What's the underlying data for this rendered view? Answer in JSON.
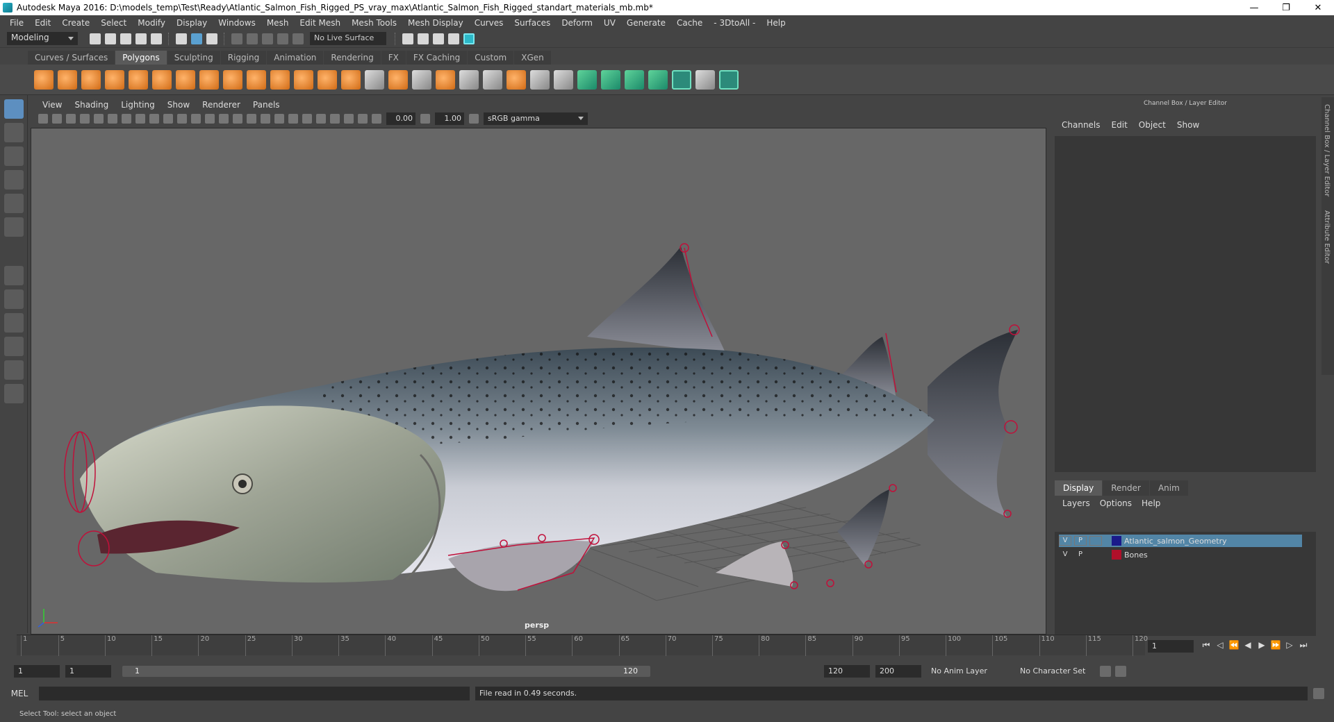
{
  "window": {
    "title": "Autodesk Maya 2016: D:\\models_temp\\Test\\Ready\\Atlantic_Salmon_Fish_Rigged_PS_vray_max\\Atlantic_Salmon_Fish_Rigged_standart_materials_mb.mb*",
    "min": "—",
    "max": "❐",
    "close": "✕"
  },
  "menubar": [
    "File",
    "Edit",
    "Create",
    "Select",
    "Modify",
    "Display",
    "Windows",
    "Mesh",
    "Edit Mesh",
    "Mesh Tools",
    "Mesh Display",
    "Curves",
    "Surfaces",
    "Deform",
    "UV",
    "Generate",
    "Cache",
    "- 3DtoAll -",
    "Help"
  ],
  "statusline": {
    "mode": "Modeling",
    "live_surface": "No Live Surface"
  },
  "shelf_tabs": [
    "Curves / Surfaces",
    "Polygons",
    "Sculpting",
    "Rigging",
    "Animation",
    "Rendering",
    "FX",
    "FX Caching",
    "Custom",
    "XGen"
  ],
  "shelf_active": "Polygons",
  "viewport": {
    "menu": [
      "View",
      "Shading",
      "Lighting",
      "Show",
      "Renderer",
      "Panels"
    ],
    "exposure": "0.00",
    "gamma_value": "1.00",
    "color_space": "sRGB gamma",
    "camera": "persp"
  },
  "channel_box": {
    "title": "Channel Box / Layer Editor",
    "menu": [
      "Channels",
      "Edit",
      "Object",
      "Show"
    ]
  },
  "layer_editor": {
    "tabs": [
      "Display",
      "Render",
      "Anim"
    ],
    "active_tab": "Display",
    "menu": [
      "Layers",
      "Options",
      "Help"
    ],
    "layers": [
      {
        "v": "V",
        "p": "P",
        "name": "Atlantic_salmon_Geometry",
        "color": "#1a1a8a",
        "selected": true
      },
      {
        "v": "V",
        "p": "P",
        "name": "Bones",
        "color": "#b0102a",
        "selected": false
      }
    ]
  },
  "side_tabs": [
    "Channel Box / Layer Editor",
    "Attribute Editor"
  ],
  "timeline": {
    "ticks": [
      "1",
      "5",
      "10",
      "15",
      "20",
      "25",
      "30",
      "35",
      "40",
      "45",
      "50",
      "55",
      "60",
      "65",
      "70",
      "75",
      "80",
      "85",
      "90",
      "95",
      "100",
      "105",
      "110",
      "115",
      "120"
    ],
    "current_frame": "1"
  },
  "range": {
    "start": "1",
    "inner_start": "1",
    "slider_start": "1",
    "slider_end": "120",
    "end": "120",
    "outer_end": "200",
    "anim_layer": "No Anim Layer",
    "char_set": "No Character Set"
  },
  "cmdline": {
    "label": "MEL",
    "output": "File read in  0.49 seconds."
  },
  "help_line": "Select Tool: select an object",
  "colors": {
    "accent": "#5285a6",
    "bones": "#c0103a"
  }
}
